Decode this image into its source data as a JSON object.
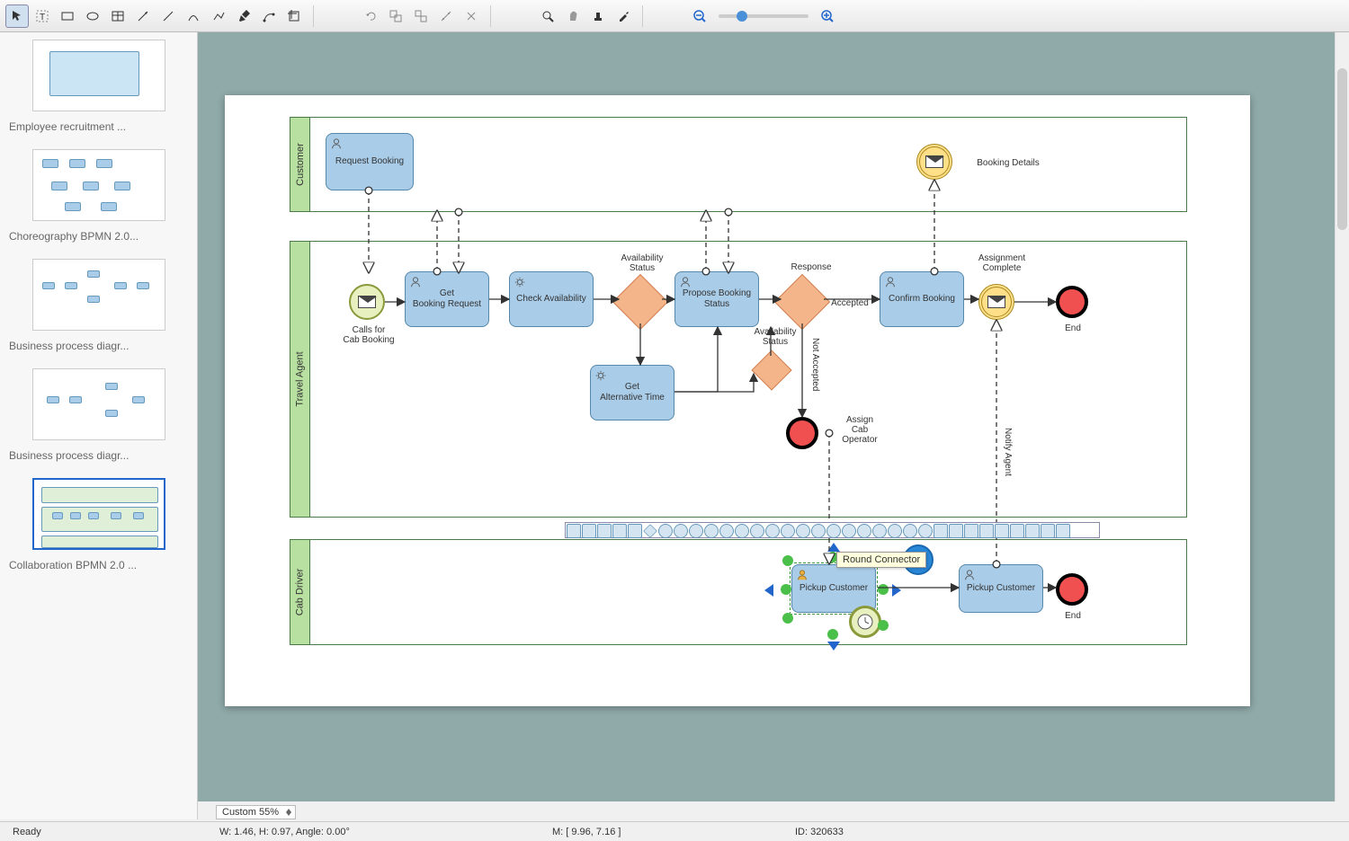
{
  "toolbar": {
    "tools": [
      "pointer",
      "text",
      "rect",
      "ellipse",
      "table",
      "connector",
      "line",
      "curve",
      "segment",
      "pen",
      "reshape",
      "crop"
    ],
    "edit": [
      "undo",
      "group",
      "ungroup",
      "align",
      "distribute"
    ],
    "view": [
      "zoom-area",
      "pan",
      "stamp",
      "eyedrop"
    ],
    "zoom": [
      "zoom-out",
      "zoom-in"
    ]
  },
  "zoom_select": "Custom 55%",
  "status": {
    "ready": "Ready",
    "dims": "W: 1.46,  H: 0.97,  Angle: 0.00°",
    "mouse": "M: [ 9.96, 7.16 ]",
    "id": "ID: 320633"
  },
  "thumbs": [
    {
      "label": "Employee recruitment ..."
    },
    {
      "label": "Choreography BPMN 2.0..."
    },
    {
      "label": "Business process diagr..."
    },
    {
      "label": "Business process diagr..."
    },
    {
      "label": "Collaboration BPMN 2.0 ..."
    }
  ],
  "lanes": {
    "customer": "Customer",
    "agent": "Travel Agent",
    "driver": "Cab Driver"
  },
  "tasks": {
    "request_booking": "Request Booking",
    "get_request": "Get\nBooking Request",
    "check_avail": "Check Availability",
    "propose_status": "Propose Booking Status",
    "confirm_booking": "Confirm Booking",
    "get_alt": "Get\nAlternative Time",
    "pickup1": "Pickup Customer",
    "pickup2": "Pickup Customer"
  },
  "labels": {
    "booking_details": "Booking Details",
    "calls_for": "Calls for\nCab Booking",
    "avail_status": "Availability\nStatus",
    "response": "Response",
    "accepted": "Accepted",
    "avail_status2": "Availability\nStatus",
    "not_accepted": "Not Accepted",
    "assign_cab": "Assign\nCab\nOperator",
    "assign_complete": "Assignment\nComplete",
    "notify_agent": "Notify Agent",
    "end1": "End",
    "end2": "End"
  },
  "tooltip": "Round Connector",
  "chart_data": {
    "type": "diagram",
    "notation": "BPMN 2.0 Collaboration",
    "pools": [
      {
        "name": "Customer",
        "elements": [
          {
            "id": "request_booking",
            "type": "user-task",
            "label": "Request Booking"
          },
          {
            "id": "booking_details_evt",
            "type": "message-event",
            "label": "Booking Details"
          }
        ]
      },
      {
        "name": "Travel Agent",
        "elements": [
          {
            "id": "start_call",
            "type": "message-start-event",
            "label": "Calls for Cab Booking"
          },
          {
            "id": "get_request",
            "type": "user-task",
            "label": "Get Booking Request"
          },
          {
            "id": "check_avail",
            "type": "service-task",
            "label": "Check Availability"
          },
          {
            "id": "gw_avail",
            "type": "gateway",
            "label": "Availability Status"
          },
          {
            "id": "propose_status",
            "type": "user-task",
            "label": "Propose Booking Status"
          },
          {
            "id": "gw_response",
            "type": "gateway",
            "label": "Response"
          },
          {
            "id": "confirm_booking",
            "type": "user-task",
            "label": "Confirm Booking"
          },
          {
            "id": "msg_assign_complete",
            "type": "message-intermediate-event",
            "label": "Assignment Complete"
          },
          {
            "id": "end_agent",
            "type": "end-event",
            "label": "End"
          },
          {
            "id": "get_alt",
            "type": "service-task",
            "label": "Get Alternative Time"
          },
          {
            "id": "gw_avail2",
            "type": "gateway",
            "label": "Availability Status"
          },
          {
            "id": "end_not_accepted",
            "type": "end-event",
            "label": ""
          }
        ]
      },
      {
        "name": "Cab Driver",
        "elements": [
          {
            "id": "pickup1",
            "type": "user-task",
            "label": "Pickup Customer",
            "boundary": [
              {
                "type": "timer"
              }
            ]
          },
          {
            "id": "pickup2",
            "type": "user-task",
            "label": "Pickup Customer"
          },
          {
            "id": "end_driver",
            "type": "end-event",
            "label": "End"
          }
        ]
      }
    ],
    "sequence_flows": [
      {
        "from": "start_call",
        "to": "get_request"
      },
      {
        "from": "get_request",
        "to": "check_avail"
      },
      {
        "from": "check_avail",
        "to": "gw_avail"
      },
      {
        "from": "gw_avail",
        "to": "propose_status"
      },
      {
        "from": "gw_avail",
        "to": "get_alt"
      },
      {
        "from": "get_alt",
        "to": "gw_avail2"
      },
      {
        "from": "gw_avail2",
        "to": "propose_status"
      },
      {
        "from": "propose_status",
        "to": "gw_response"
      },
      {
        "from": "gw_response",
        "to": "confirm_booking",
        "label": "Accepted"
      },
      {
        "from": "gw_response",
        "to": "end_not_accepted",
        "label": "Not Accepted"
      },
      {
        "from": "confirm_booking",
        "to": "msg_assign_complete"
      },
      {
        "from": "msg_assign_complete",
        "to": "end_agent"
      },
      {
        "from": "pickup1",
        "to": "pickup2"
      },
      {
        "from": "pickup2",
        "to": "end_driver"
      }
    ],
    "message_flows": [
      {
        "from": "request_booking",
        "to": "get_request"
      },
      {
        "from": "propose_status",
        "to": "Customer"
      },
      {
        "from": "Customer",
        "to": "propose_status"
      },
      {
        "from": "confirm_booking",
        "to": "booking_details_evt"
      },
      {
        "from": "gw_response",
        "to": "pickup1",
        "label": "Assign Cab Operator"
      },
      {
        "from": "pickup2",
        "to": "msg_assign_complete",
        "label": "Notify Agent"
      }
    ]
  }
}
